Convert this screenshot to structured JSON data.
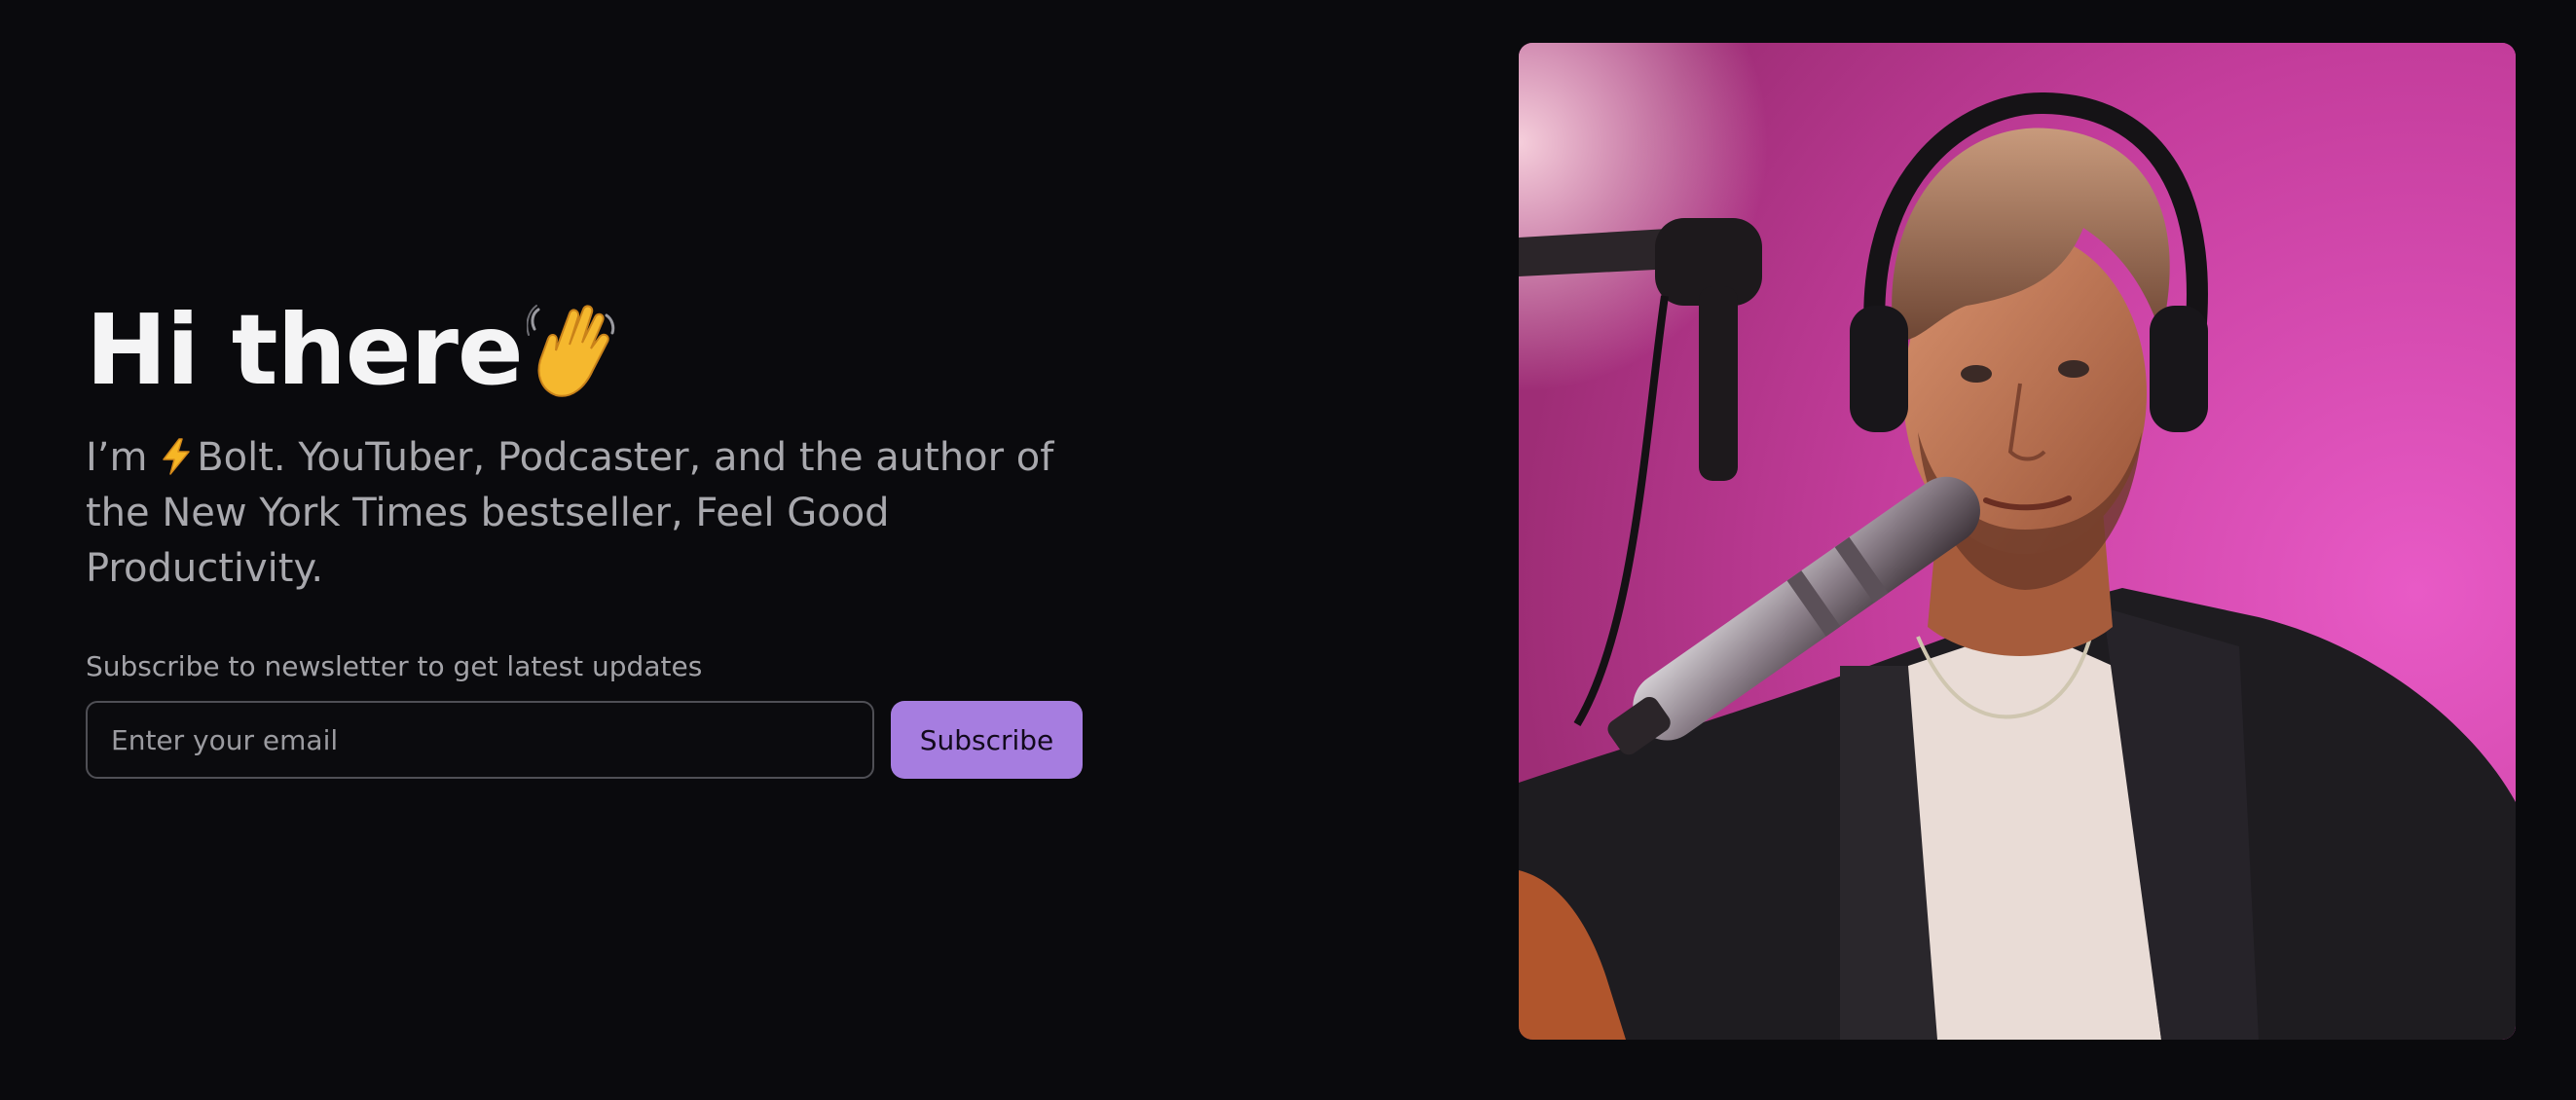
{
  "hero": {
    "title": "Hi there",
    "title_emoji": "waving-hand-icon",
    "intro_prefix": "I’m ",
    "intro_icon": "lightning-bolt-icon",
    "intro_text": "Bolt. YouTuber, Podcaster, and the author of the New York Times bestseller, Feel Good Productivity."
  },
  "newsletter": {
    "label": "Subscribe to newsletter to get latest updates",
    "email_placeholder": "Enter your email",
    "email_value": "",
    "button_label": "Subscribe"
  },
  "photo": {
    "subject": "portrait-photo"
  },
  "colors": {
    "background": "#0a0a0d",
    "accent": "#a67de0",
    "photo_backdrop": "#c03c98"
  }
}
